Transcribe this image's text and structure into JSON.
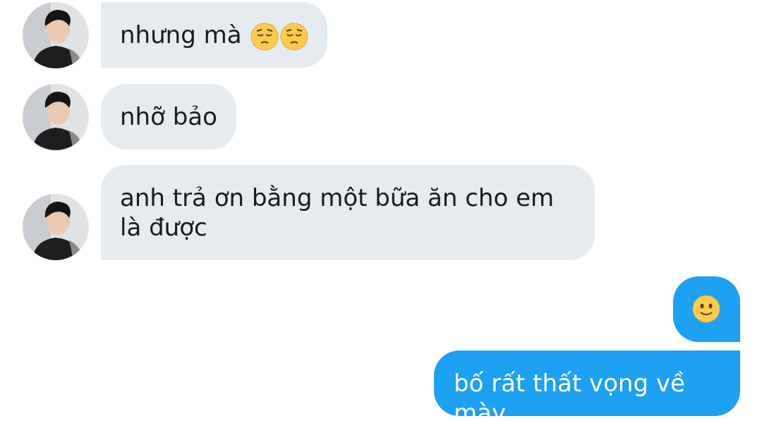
{
  "messages": [
    {
      "direction": "received",
      "text": "nhưng mà",
      "emoji": [
        "pensive-face",
        "pensive-face"
      ]
    },
    {
      "direction": "received",
      "text": "nhỡ bảo"
    },
    {
      "direction": "received",
      "text": "anh trả ơn bằng một bữa ăn cho em là được"
    },
    {
      "direction": "sent",
      "text": "",
      "emoji": [
        "slightly-smiling-face"
      ]
    },
    {
      "direction": "sent",
      "text": "bố rất thất vọng về mày"
    }
  ],
  "colors": {
    "received_bubble": "#e6ebf0",
    "sent_bubble": "#1da1f2",
    "received_text": "#1b1b1b",
    "sent_text": "#ffffff"
  }
}
